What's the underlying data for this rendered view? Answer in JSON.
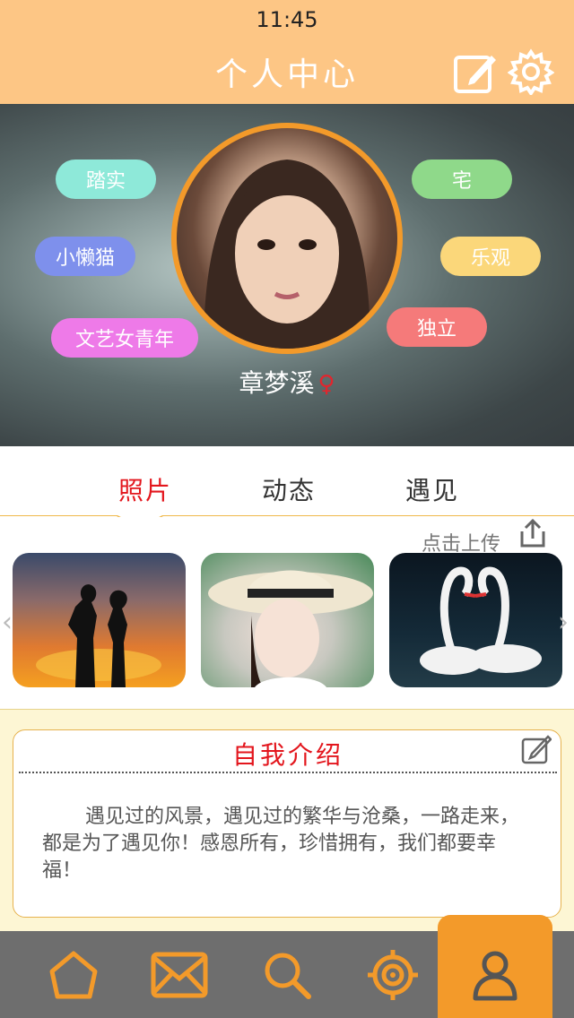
{
  "status": {
    "time": "11:45"
  },
  "header": {
    "title": "个人中心"
  },
  "profile": {
    "name": "章梦溪",
    "gender_symbol": "♀",
    "tags": [
      "踏实",
      "宅",
      "小懒猫",
      "乐观",
      "文艺女青年",
      "独立"
    ]
  },
  "tabs": [
    {
      "label": "照片",
      "active": true
    },
    {
      "label": "动态",
      "active": false
    },
    {
      "label": "遇见",
      "active": false
    }
  ],
  "photos": {
    "upload_label": "点击上传"
  },
  "intro": {
    "title": "自我介绍",
    "text": "遇见过的风景，遇见过的繁华与沧桑，一路走来，都是为了遇见你！感恩所有，珍惜拥有，我们都要幸福！"
  },
  "bottom_nav": [
    "home-icon",
    "mail-icon",
    "search-icon",
    "target-icon",
    "profile-icon"
  ],
  "colors": {
    "accent": "#f39a2a",
    "header": "#fdc685",
    "active_tab": "#e3161d"
  }
}
